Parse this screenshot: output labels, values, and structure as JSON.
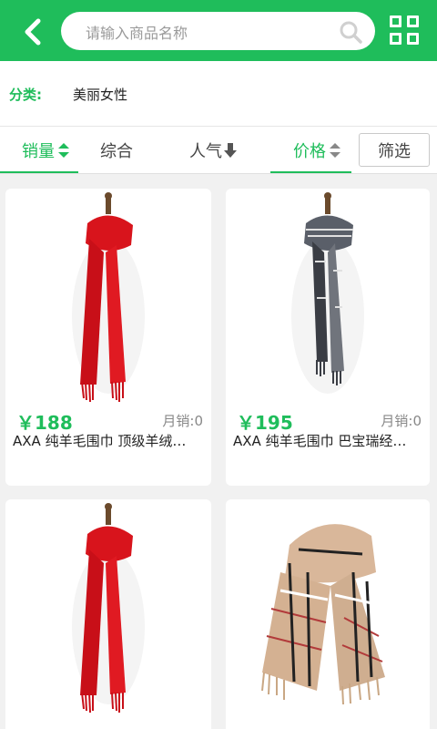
{
  "header": {
    "search_placeholder": "请输入商品名称",
    "colors": {
      "brand": "#1fbd5b"
    }
  },
  "category": {
    "label": "分类:",
    "value": "美丽女性"
  },
  "sortbar": {
    "sales": "销量",
    "overall": "综合",
    "popularity": "人气",
    "price": "价格",
    "filter": "筛选"
  },
  "products": [
    {
      "price": "￥188",
      "sales": "月销:0",
      "title": "AXA 纯羊毛围巾 顶级羊绒…",
      "image": "red-scarf"
    },
    {
      "price": "￥195",
      "sales": "月销:0",
      "title": "AXA 纯羊毛围巾 巴宝瑞经…",
      "image": "gray-plaid-scarf"
    },
    {
      "image": "red-scarf"
    },
    {
      "image": "beige-plaid-scarf"
    }
  ]
}
